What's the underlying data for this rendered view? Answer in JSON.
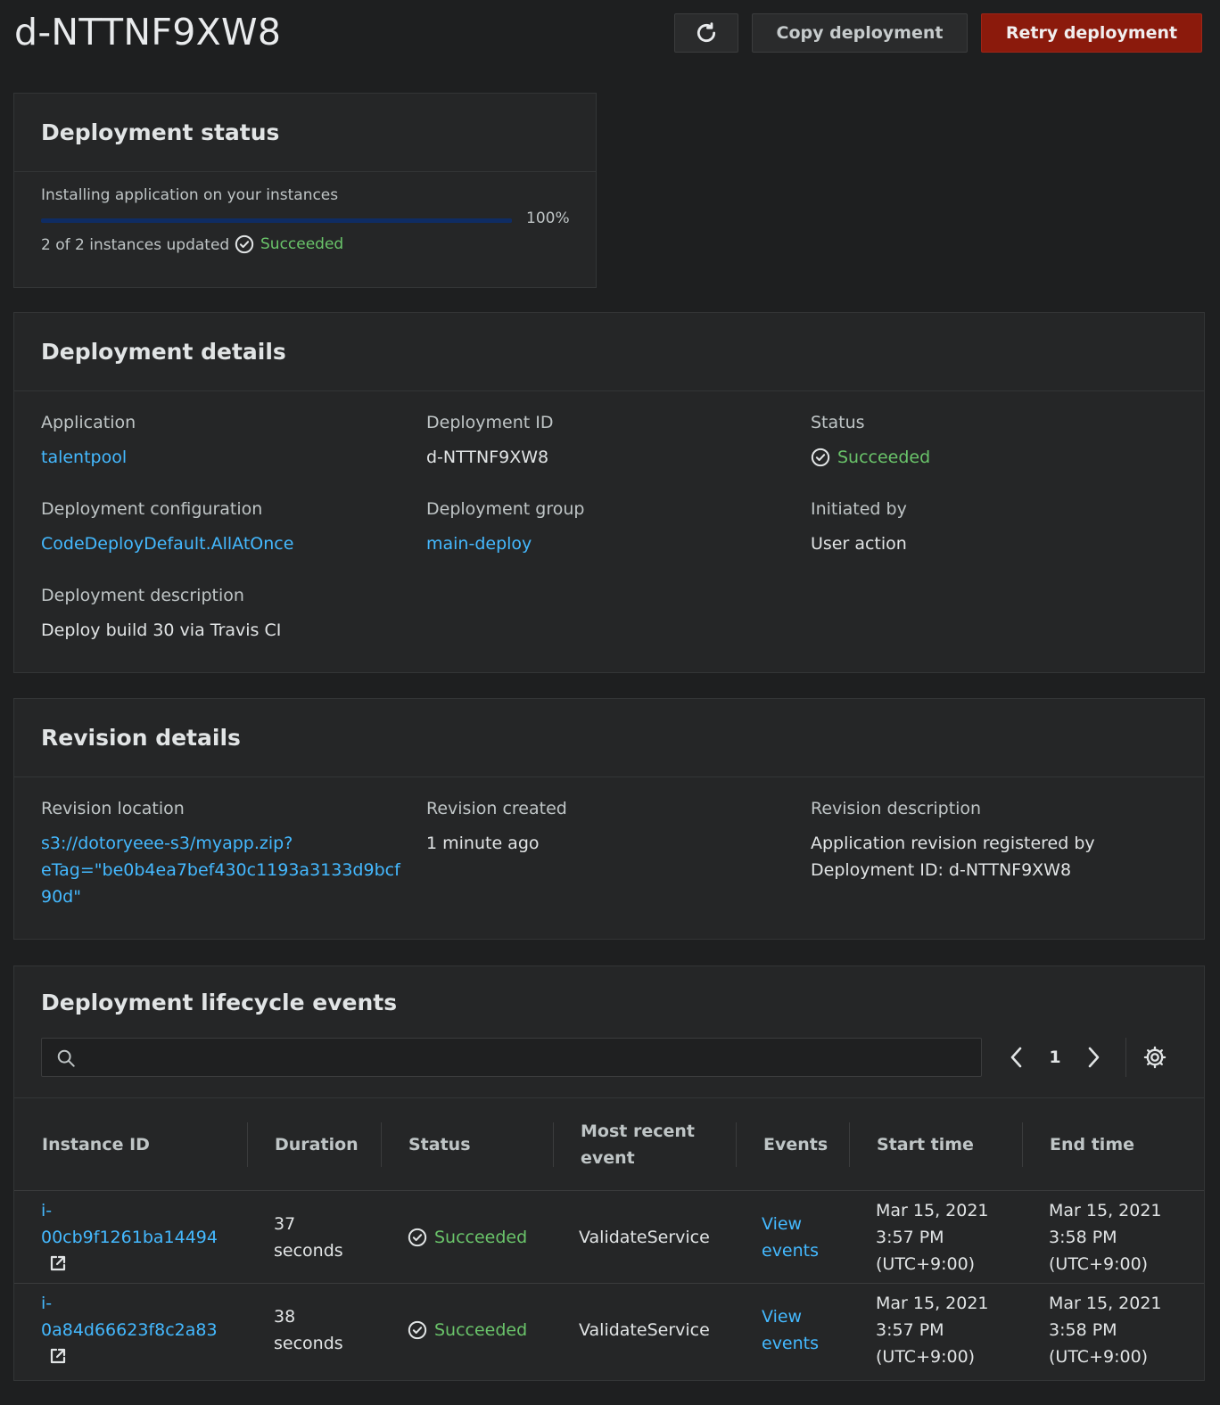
{
  "page": {
    "title": "d-NTTNF9XW8",
    "copy_label": "Copy deployment",
    "retry_label": "Retry deployment"
  },
  "colors": {
    "background": "#1e1f20",
    "panel": "#252627",
    "link": "#44b9ff",
    "success": "#6ac46a",
    "retry_button": "#8b1a0c",
    "progress_bar": "#0f2c63"
  },
  "icons": {
    "refresh": "refresh-icon",
    "success": "check-circle-icon",
    "search": "search-icon",
    "prev": "chevron-left-icon",
    "next": "chevron-right-icon",
    "settings": "gear-icon",
    "external": "external-link-icon"
  },
  "status_panel": {
    "heading": "Deployment status",
    "progress_label": "Installing application on your instances",
    "progress_percent": 100,
    "progress_text": "100%",
    "instances_text": "2 of 2 instances updated",
    "status": "Succeeded"
  },
  "details": {
    "heading": "Deployment details",
    "application_label": "Application",
    "application_value": "talentpool",
    "deployment_id_label": "Deployment ID",
    "deployment_id_value": "d-NTTNF9XW8",
    "status_label": "Status",
    "status_value": "Succeeded",
    "config_label": "Deployment configuration",
    "config_value": "CodeDeployDefault.AllAtOnce",
    "group_label": "Deployment group",
    "group_value": "main-deploy",
    "initiated_label": "Initiated by",
    "initiated_value": "User action",
    "description_label": "Deployment description",
    "description_value": "Deploy build 30 via Travis CI"
  },
  "revision": {
    "heading": "Revision details",
    "location_label": "Revision location",
    "location_line1": "s3://dotoryeee-s3/myapp.zip?",
    "location_line2": "eTag=\"be0b4ea7bef430c1193a3133d9bcf",
    "location_line3": "90d\"",
    "created_label": "Revision created",
    "created_value": "1 minute ago",
    "description_label": "Revision description",
    "description_line1": "Application revision registered by",
    "description_line2": "Deployment ID: d-NTTNF9XW8"
  },
  "events": {
    "heading": "Deployment lifecycle events",
    "page_number": "1",
    "columns": {
      "instance_id": "Instance ID",
      "duration": "Duration",
      "status": "Status",
      "recent_event_1": "Most recent",
      "recent_event_2": "event",
      "events": "Events",
      "start_time": "Start time",
      "end_time": "End time"
    },
    "rows": [
      {
        "instance_prefix": "i-",
        "instance_rest": "00cb9f1261ba14494",
        "duration_num": "37",
        "duration_unit": "seconds",
        "status": "Succeeded",
        "recent_event": "ValidateService",
        "events_1": "View",
        "events_2": "events",
        "start_date": "Mar 15, 2021",
        "start_time": "3:57 PM",
        "start_tz": "(UTC+9:00)",
        "end_date": "Mar 15, 2021",
        "end_time": "3:58 PM",
        "end_tz": "(UTC+9:00)"
      },
      {
        "instance_prefix": "i-",
        "instance_rest": "0a84d66623f8c2a83",
        "duration_num": "38",
        "duration_unit": "seconds",
        "status": "Succeeded",
        "recent_event": "ValidateService",
        "events_1": "View",
        "events_2": "events",
        "start_date": "Mar 15, 2021",
        "start_time": "3:57 PM",
        "start_tz": "(UTC+9:00)",
        "end_date": "Mar 15, 2021",
        "end_time": "3:58 PM",
        "end_tz": "(UTC+9:00)"
      }
    ]
  }
}
